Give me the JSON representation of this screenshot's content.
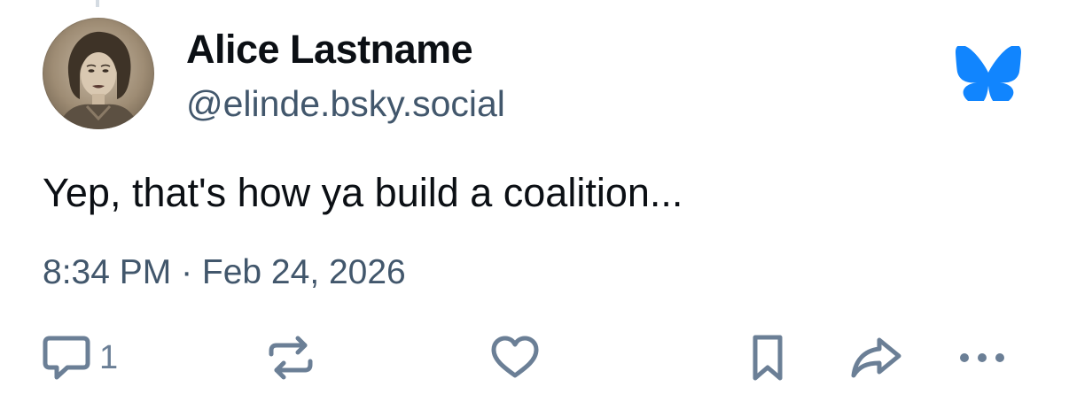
{
  "post": {
    "author": {
      "display_name": "Alice Lastname",
      "handle": "@elinde.bsky.social"
    },
    "text": "Yep, that's how ya build a coalition...",
    "timestamp": "8:34 PM · Feb 24, 2026"
  },
  "actions": {
    "reply_count": "1"
  },
  "icons": {
    "brand": "bluesky-butterfly-icon",
    "reply": "speech-bubble-icon",
    "repost": "repost-arrows-icon",
    "like": "heart-icon",
    "bookmark": "bookmark-icon",
    "share": "share-arrow-icon",
    "more": "ellipsis-icon"
  },
  "colors": {
    "brand_blue": "#1185fe",
    "icon_gray": "#6b7f96",
    "secondary_text": "#42576c"
  }
}
